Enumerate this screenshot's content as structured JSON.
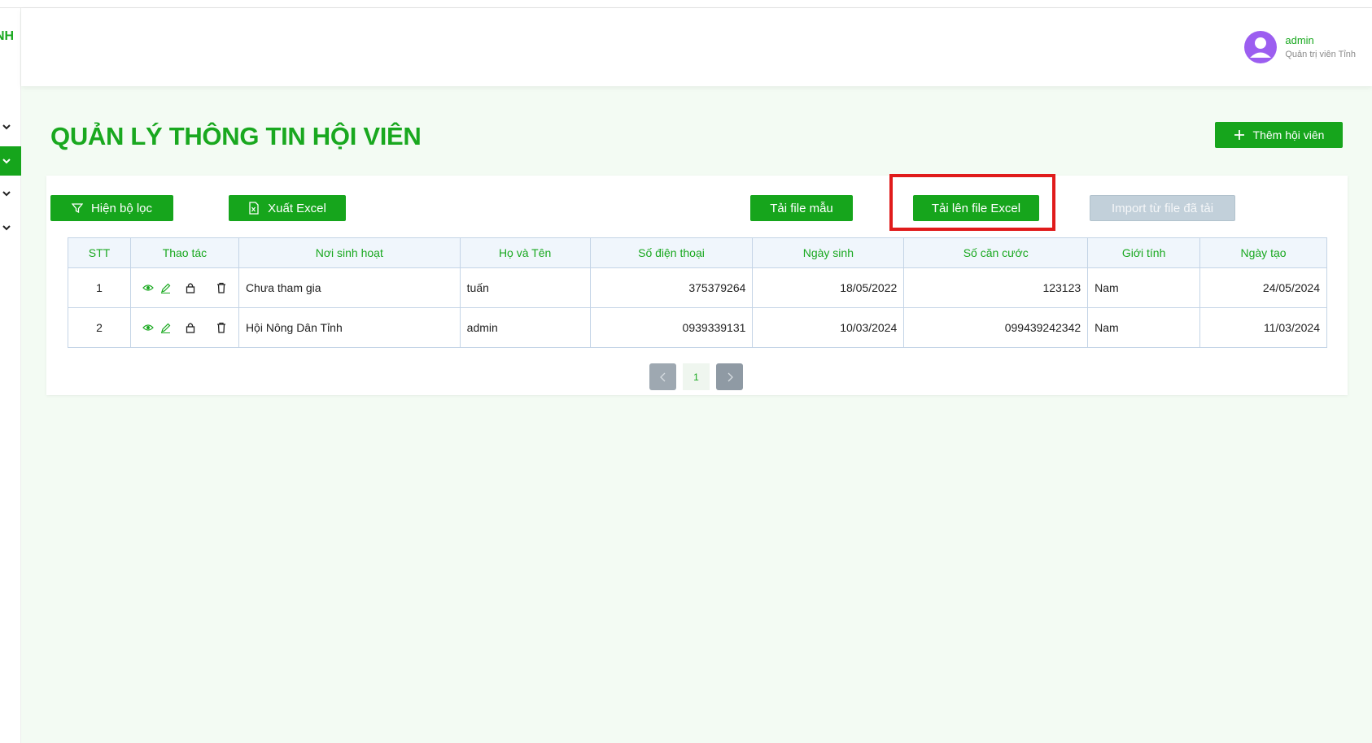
{
  "sidebar": {
    "brand": "NH"
  },
  "header": {
    "user_name": "admin",
    "user_role": "Quản trị viên Tỉnh"
  },
  "page": {
    "title": "QUẢN LÝ THÔNG TIN HỘI VIÊN",
    "add_label": "Thêm hội viên"
  },
  "toolbar": {
    "filter_label": "Hiện bộ lọc",
    "export_label": "Xuất Excel",
    "template_label": "Tải file mẫu",
    "upload_label": "Tải lên file Excel",
    "import_label": "Import từ file đã tải"
  },
  "table": {
    "headers": [
      "STT",
      "Thao tác",
      "Nơi sinh hoạt",
      "Họ và Tên",
      "Số điện thoại",
      "Ngày sinh",
      "Số căn cước",
      "Giới tính",
      "Ngày tạo"
    ],
    "rows": [
      {
        "stt": "1",
        "place": "Chưa tham gia",
        "name": "tuấn",
        "phone": "375379264",
        "dob": "18/05/2022",
        "id_no": "123123",
        "gender": "Nam",
        "created": "24/05/2024"
      },
      {
        "stt": "2",
        "place": "Hội Nông Dân Tỉnh",
        "name": "admin",
        "phone": "0939339131",
        "dob": "10/03/2024",
        "id_no": "099439242342",
        "gender": "Nam",
        "created": "11/03/2024"
      }
    ]
  },
  "pagination": {
    "current": "1"
  },
  "colors": {
    "brand": "#16a51c",
    "highlight": "#e01b1b",
    "disabled": "#c2d0da"
  },
  "icons": [
    "filter-icon",
    "excel-file-icon",
    "plus-icon",
    "eye-icon",
    "edit-icon",
    "lock-icon",
    "trash-icon",
    "chevron-down-icon",
    "user-avatar-icon",
    "chevron-left-icon",
    "chevron-right-icon"
  ]
}
